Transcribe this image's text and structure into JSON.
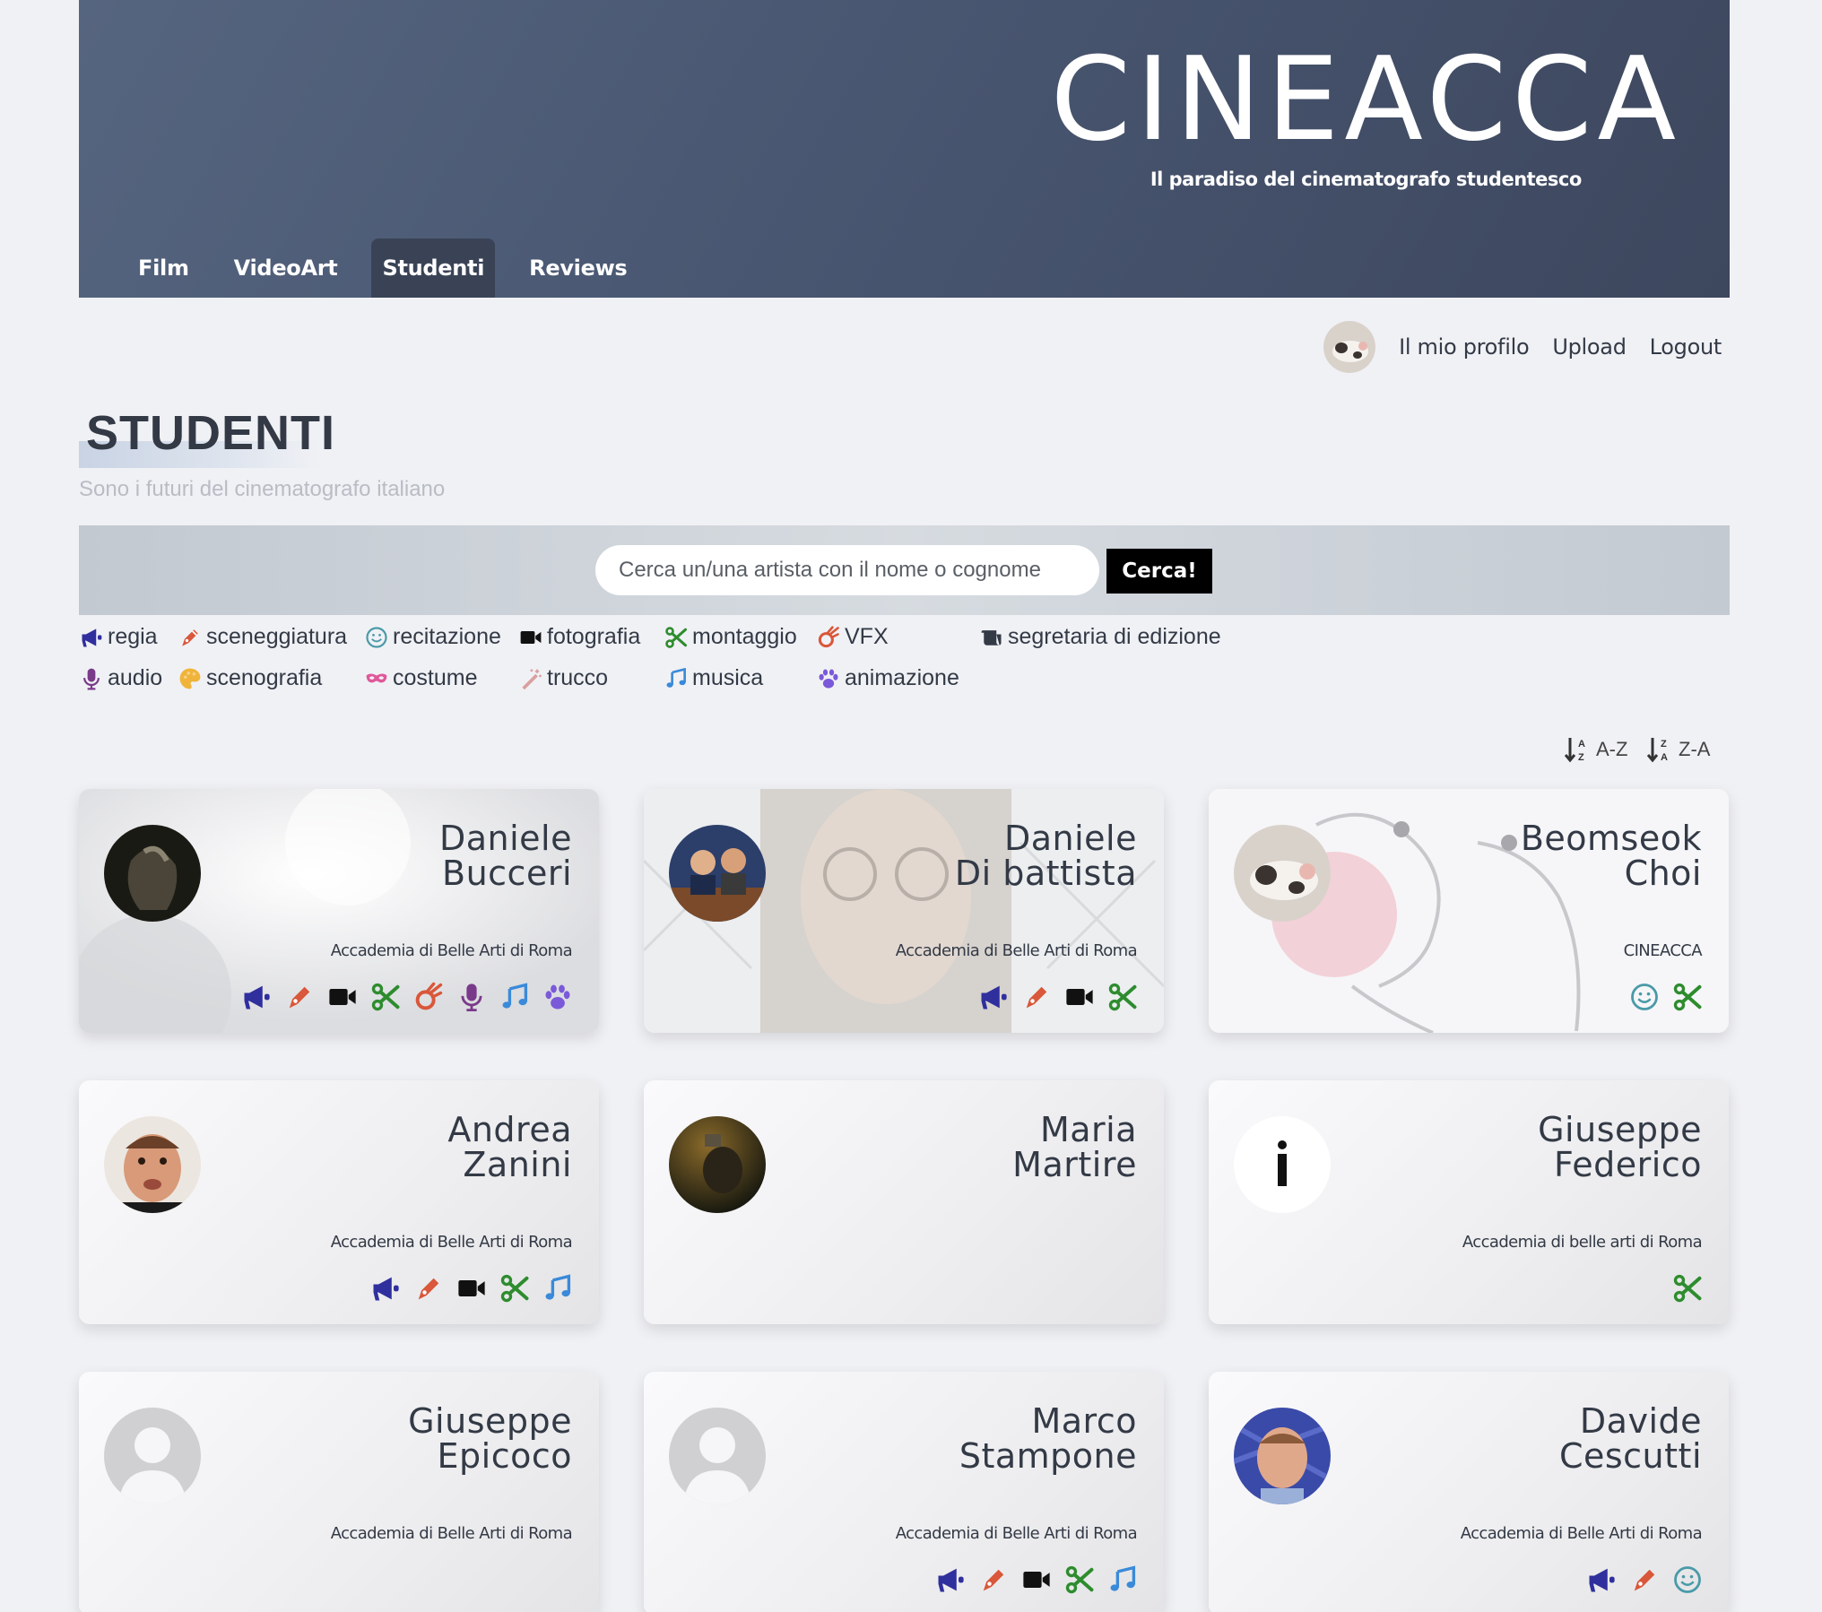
{
  "header": {
    "brand_title": "CINEACCA",
    "brand_subtitle": "Il paradiso del cinematografo studentesco",
    "nav": [
      {
        "label": "Film",
        "active": false
      },
      {
        "label": "VideoArt",
        "active": false
      },
      {
        "label": "Studenti",
        "active": true
      },
      {
        "label": "Reviews",
        "active": false
      }
    ]
  },
  "userbar": {
    "profile": "Il mio profilo",
    "upload": "Upload",
    "logout": "Logout"
  },
  "page": {
    "title": "STUDENTI",
    "subtitle": "Sono i futuri del cinematografo italiano"
  },
  "search": {
    "placeholder": "Cerca un/una artista con il nome o cognome",
    "button": "Cerca!"
  },
  "legend": [
    {
      "key": "regia",
      "label": "regia",
      "icon": "megaphone-icon",
      "color": "#2f2f9e"
    },
    {
      "key": "sceneggiatura",
      "label": "sceneggiatura",
      "icon": "pen-icon",
      "color": "#d9573a"
    },
    {
      "key": "recitazione",
      "label": "recitazione",
      "icon": "smile-icon",
      "color": "#4a9aa8"
    },
    {
      "key": "fotografia",
      "label": "fotografia",
      "icon": "video-camera-icon",
      "color": "#111111"
    },
    {
      "key": "montaggio",
      "label": "montaggio",
      "icon": "scissors-icon",
      "color": "#2e8c2e"
    },
    {
      "key": "vfx",
      "label": "VFX",
      "icon": "meteor-icon",
      "color": "#d9573a"
    },
    {
      "key": "segretaria",
      "label": "segretaria di edizione",
      "icon": "scroll-icon",
      "color": "#333a46"
    },
    {
      "key": "audio",
      "label": "audio",
      "icon": "microphone-icon",
      "color": "#7a3a8a"
    },
    {
      "key": "scenografia",
      "label": "scenografia",
      "icon": "palette-icon",
      "color": "#f0b43a"
    },
    {
      "key": "costume",
      "label": "costume",
      "icon": "mask-icon",
      "color": "#e0589a"
    },
    {
      "key": "trucco",
      "label": "trucco",
      "icon": "magic-wand-icon",
      "color": "#d9a0a0"
    },
    {
      "key": "musica",
      "label": "musica",
      "icon": "music-icon",
      "color": "#3a8ad9"
    },
    {
      "key": "animazione",
      "label": "animazione",
      "icon": "paw-icon",
      "color": "#7a5ad9"
    }
  ],
  "sort": {
    "asc": "A-Z",
    "desc": "Z-A"
  },
  "students": [
    {
      "first": "Daniele",
      "last": "Bucceri",
      "school": "Accademia di Belle Arti di Roma",
      "roles": [
        "regia",
        "sceneggiatura",
        "fotografia",
        "montaggio",
        "vfx",
        "audio",
        "musica",
        "animazione"
      ]
    },
    {
      "first": "Daniele",
      "last": "Di battista",
      "school": "Accademia di Belle Arti di Roma",
      "roles": [
        "regia",
        "sceneggiatura",
        "fotografia",
        "montaggio"
      ]
    },
    {
      "first": "Beomseok",
      "last": "Choi",
      "school": "CINEACCA",
      "roles": [
        "recitazione",
        "montaggio"
      ]
    },
    {
      "first": "Andrea",
      "last": "Zanini",
      "school": "Accademia di Belle Arti di Roma",
      "roles": [
        "regia",
        "sceneggiatura",
        "fotografia",
        "montaggio",
        "musica"
      ]
    },
    {
      "first": "Maria",
      "last": "Martire",
      "school": "",
      "roles": []
    },
    {
      "first": "Giuseppe",
      "last": "Federico",
      "school": "Accademia di belle arti di Roma",
      "roles": [
        "montaggio"
      ]
    },
    {
      "first": "Giuseppe",
      "last": "Epicoco",
      "school": "Accademia di Belle Arti di Roma",
      "roles": []
    },
    {
      "first": "Marco",
      "last": "Stampone",
      "school": "Accademia di Belle Arti di Roma",
      "roles": [
        "regia",
        "sceneggiatura",
        "fotografia",
        "montaggio",
        "musica"
      ]
    },
    {
      "first": "Davide",
      "last": "Cescutti",
      "school": "Accademia di Belle Arti di Roma",
      "roles": [
        "regia",
        "sceneggiatura",
        "recitazione"
      ]
    }
  ]
}
